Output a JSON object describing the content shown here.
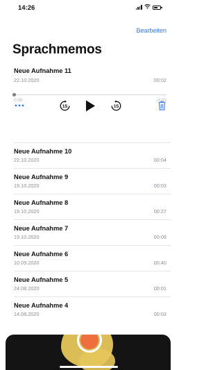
{
  "status_bar": {
    "time": "14:26"
  },
  "header": {
    "edit_label": "Bearbeiten",
    "title": "Sprachmemos"
  },
  "expanded_recording": {
    "name": "Neue Aufnahme 11",
    "date": "22.10.2020",
    "duration": "00:02",
    "elapsed": "0:00",
    "remaining": "-0:02",
    "progress": 0.0,
    "skip_back_label": "15",
    "skip_forward_label": "15"
  },
  "recordings": [
    {
      "name": "Neue Aufnahme 10",
      "date": "22.10.2020",
      "duration": "00:04"
    },
    {
      "name": "Neue Aufnahme 9",
      "date": "19.10.2020",
      "duration": "00:03"
    },
    {
      "name": "Neue Aufnahme 8",
      "date": "19.10.2020",
      "duration": "00:27"
    },
    {
      "name": "Neue Aufnahme 7",
      "date": "19.10.2020",
      "duration": "00:09"
    },
    {
      "name": "Neue Aufnahme 6",
      "date": "10.09.2020",
      "duration": "00:40"
    },
    {
      "name": "Neue Aufnahme 5",
      "date": "24.08.2020",
      "duration": "00:01"
    },
    {
      "name": "Neue Aufnahme 4",
      "date": "14.08.2020",
      "duration": "00:03"
    }
  ],
  "colors": {
    "accent": "#3478f6",
    "record": "#ec6f3d",
    "panel": "#141414",
    "secondary_text": "#8e8e93"
  },
  "icons": [
    "signal-icon",
    "wifi-icon",
    "battery-icon",
    "more-icon",
    "skip-back-15-icon",
    "play-icon",
    "skip-forward-15-icon",
    "trash-icon",
    "record-icon"
  ]
}
